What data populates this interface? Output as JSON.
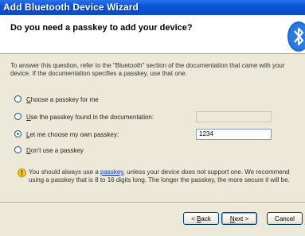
{
  "window": {
    "title": "Add Bluetooth Device Wizard"
  },
  "header": {
    "question": "Do you need a passkey to add your device?",
    "logo_icon": "bluetooth-icon"
  },
  "intro": "To answer this question, refer to the \"Bluetooth\" section of the documentation that came with your device. If the documentation specifies a passkey, use that one.",
  "options": [
    {
      "prefix_u": "C",
      "rest": "hoose a passkey for me",
      "selected": false
    },
    {
      "prefix_u": "U",
      "rest": "se the passkey found in the documentation:",
      "selected": false
    },
    {
      "prefix_u": "L",
      "rest": "et me choose my own passkey:",
      "selected": true
    },
    {
      "prefix_u": "D",
      "rest": "on't use a passkey",
      "selected": false
    }
  ],
  "fields": {
    "documentation_passkey": "",
    "own_passkey": "1234"
  },
  "note": {
    "before": "You should always use a ",
    "link": "passkey",
    "after": ", unless your device does not support one. We recommend using a passkey that is 8 to 16 digits long. The longer the passkey, the more secure it will be.",
    "icon": "warning-icon"
  },
  "buttons": {
    "back_prefix": "< ",
    "back_u": "B",
    "back_rest": "ack",
    "next_u": "N",
    "next_rest": "ext >",
    "cancel": "Cancel"
  }
}
